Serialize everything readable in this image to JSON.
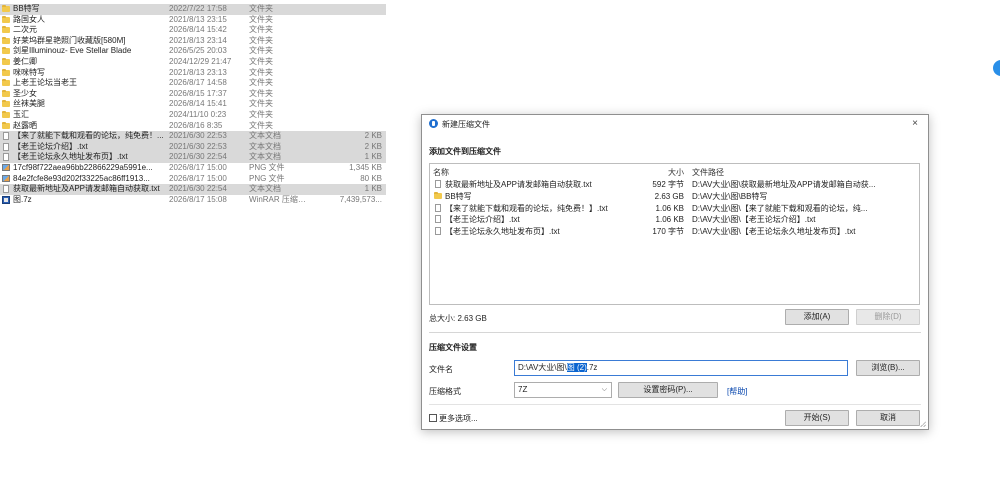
{
  "explorer": {
    "rows": [
      {
        "icon": "folder",
        "name": "BB特写",
        "date": "2022/7/22 17:58",
        "type": "文件夹",
        "size": "",
        "selected": true
      },
      {
        "icon": "folder",
        "name": "路国女人",
        "date": "2021/8/13 23:15",
        "type": "文件夹",
        "size": "",
        "selected": false
      },
      {
        "icon": "folder",
        "name": "二次元",
        "date": "2026/8/14 15:42",
        "type": "文件夹",
        "size": "",
        "selected": false
      },
      {
        "icon": "folder",
        "name": "好莱坞群星艳照门收藏版[580M]",
        "date": "2021/8/13 23:14",
        "type": "文件夹",
        "size": "",
        "selected": false
      },
      {
        "icon": "folder",
        "name": "剑星Illuminouz- Eve Stellar Blade",
        "date": "2026/5/25 20:03",
        "type": "文件夹",
        "size": "",
        "selected": false
      },
      {
        "icon": "folder",
        "name": "姜仁卿",
        "date": "2024/12/29 21:47",
        "type": "文件夹",
        "size": "",
        "selected": false
      },
      {
        "icon": "folder",
        "name": "咪咪特写",
        "date": "2021/8/13 23:13",
        "type": "文件夹",
        "size": "",
        "selected": false
      },
      {
        "icon": "folder",
        "name": "上老王论坛当老王",
        "date": "2026/8/17 14:58",
        "type": "文件夹",
        "size": "",
        "selected": false
      },
      {
        "icon": "folder",
        "name": "圣少女",
        "date": "2026/8/15 17:37",
        "type": "文件夹",
        "size": "",
        "selected": false
      },
      {
        "icon": "folder",
        "name": "丝袜美腿",
        "date": "2026/8/14 15:41",
        "type": "文件夹",
        "size": "",
        "selected": false
      },
      {
        "icon": "folder",
        "name": "玉汇",
        "date": "2024/11/10 0:23",
        "type": "文件夹",
        "size": "",
        "selected": false
      },
      {
        "icon": "folder",
        "name": "赵露晒",
        "date": "2026/8/16 8:35",
        "type": "文件夹",
        "size": "",
        "selected": false
      },
      {
        "icon": "txt",
        "name": "【来了就能下载和观看的论坛，纯免费！...",
        "date": "2021/6/30 22:53",
        "type": "文本文档",
        "size": "2 KB",
        "selected": true
      },
      {
        "icon": "txt",
        "name": "【老王论坛介绍】.txt",
        "date": "2021/6/30 22:53",
        "type": "文本文档",
        "size": "2 KB",
        "selected": true
      },
      {
        "icon": "txt",
        "name": "【老王论坛永久地址发布页】.txt",
        "date": "2021/6/30 22:54",
        "type": "文本文档",
        "size": "1 KB",
        "selected": true
      },
      {
        "icon": "png",
        "name": "17cf98f722aea96bb22866229a5991e...",
        "date": "2026/8/17 15:00",
        "type": "PNG 文件",
        "size": "1,345 KB",
        "selected": false
      },
      {
        "icon": "png",
        "name": "84e2fcfe8e93d202f33225ac86ff1913...",
        "date": "2026/8/17 15:00",
        "type": "PNG 文件",
        "size": "80 KB",
        "selected": false
      },
      {
        "icon": "txt",
        "name": "获取最新地址及APP请发邮箱自动获取.txt",
        "date": "2021/6/30 22:54",
        "type": "文本文档",
        "size": "1 KB",
        "selected": true
      },
      {
        "icon": "7z",
        "name": "图.7z",
        "date": "2026/8/17 15:08",
        "type": "WinRAR 压缩文件",
        "size": "7,439,573...",
        "selected": false
      }
    ]
  },
  "dialog": {
    "title": "新建压缩文件",
    "close_glyph": "×",
    "add_files_heading": "添加文件到压缩文件",
    "columns": {
      "name": "名称",
      "size": "大小",
      "path": "文件路径"
    },
    "files": [
      {
        "icon": "txt",
        "name": "获取最新地址及APP请发邮箱自动获取.txt",
        "size": "592 字节",
        "path": "D:\\AV大业\\图\\获取最新地址及APP请发邮箱自动获..."
      },
      {
        "icon": "folder",
        "name": "BB特写",
        "size": "2.63 GB",
        "path": "D:\\AV大业\\图\\BB特写"
      },
      {
        "icon": "txt",
        "name": "【来了就能下载和观看的论坛，纯免费！】.txt",
        "size": "1.06 KB",
        "path": "D:\\AV大业\\图\\【来了就能下载和观看的论坛，纯..."
      },
      {
        "icon": "txt",
        "name": "【老王论坛介绍】.txt",
        "size": "1.06 KB",
        "path": "D:\\AV大业\\图\\【老王论坛介绍】.txt"
      },
      {
        "icon": "txt",
        "name": "【老王论坛永久地址发布页】.txt",
        "size": "170 字节",
        "path": "D:\\AV大业\\图\\【老王论坛永久地址发布页】.txt"
      }
    ],
    "total_size": "总大小: 2.63 GB",
    "add_button": "添加(A)",
    "remove_button": "删除(D)",
    "settings_heading": "压缩文件设置",
    "filename_label": "文件名",
    "filename_prefix": "D:\\AV大业\\图\\",
    "filename_selected": "图 (2)",
    "filename_suffix": ".7z",
    "browse_button": "浏览(B)...",
    "format_label": "压缩格式",
    "format_value": "7Z",
    "format_chevron": "⌵",
    "password_button": "设置密码(P)...",
    "help_link": "[帮助]",
    "more_options": "更多选项...",
    "start_button": "开始(S)",
    "cancel_button": "取消"
  }
}
